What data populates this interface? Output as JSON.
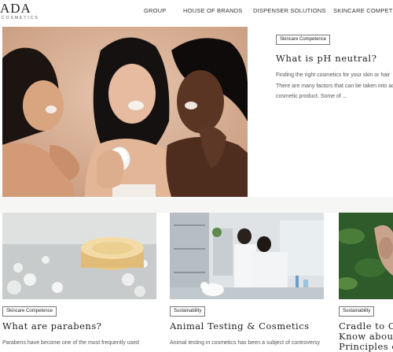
{
  "brand": {
    "logo_text": "ADA",
    "logo_sub": "COSMETICS"
  },
  "nav": {
    "items": [
      {
        "label": "GROUP"
      },
      {
        "label": "HOUSE OF BRANDS"
      },
      {
        "label": "DISPENSER SOLUTIONS"
      },
      {
        "label": "SKINCARE COMPETENCE"
      }
    ]
  },
  "featured": {
    "category": "Skincare Competence",
    "title": "What is pH neutral?",
    "excerpt_lines": [
      "Finding the right cosmetics for your skin or hair",
      "There are many factors that can be taken into ac",
      "cosmetic product. Some of ..."
    ],
    "image_icon": "women-skincare-photo"
  },
  "articles": [
    {
      "category": "Skincare Competence",
      "title": "What are parabens?",
      "excerpt": "Parabens have become one of the most frequently used",
      "image_icon": "cream-bubbles-photo"
    },
    {
      "category": "Sustainability",
      "title": "Animal Testing & Cosmetics",
      "excerpt": "Animal testing in cosmetics has been a subject of controversy",
      "image_icon": "lab-scientists-photo"
    },
    {
      "category": "Sustainability",
      "title_lines": [
        "Cradle to Cra",
        "Know about",
        "Principles of"
      ],
      "image_icon": "green-leaves-photo"
    }
  ]
}
